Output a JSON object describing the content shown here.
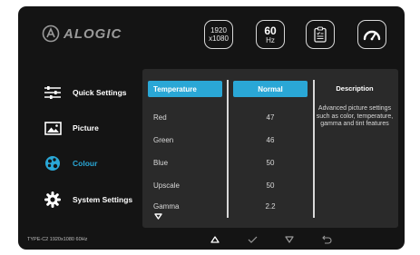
{
  "brand": {
    "name": "ALOGIC"
  },
  "header": {
    "resolution": {
      "top": "1920",
      "bottom": "x1080"
    },
    "refresh": {
      "value": "60",
      "unit": "Hz"
    }
  },
  "sidebar": {
    "items": [
      {
        "label": "Quick Settings",
        "icon": "sliders-icon"
      },
      {
        "label": "Picture",
        "icon": "picture-icon"
      },
      {
        "label": "Colour",
        "icon": "palette-icon",
        "active": true
      },
      {
        "label": "System Settings",
        "icon": "gear-icon"
      }
    ]
  },
  "panel": {
    "selected": {
      "label": "Temperature",
      "value": "Normal"
    },
    "rows": [
      {
        "label": "Red",
        "value": "47"
      },
      {
        "label": "Green",
        "value": "46"
      },
      {
        "label": "Blue",
        "value": "50"
      },
      {
        "label": "Upscale",
        "value": "50"
      },
      {
        "label": "Gamma",
        "value": "2.2"
      }
    ],
    "description": {
      "title": "Description",
      "text": "Advanced picture settings such as color, temperature, gamma and tint features"
    }
  },
  "footer": {
    "status": "TYPE-C2   1920x1080 60Hz"
  },
  "colors": {
    "accent": "#2aa7d6",
    "background": "#141414",
    "panel": "#2a2a2a"
  }
}
